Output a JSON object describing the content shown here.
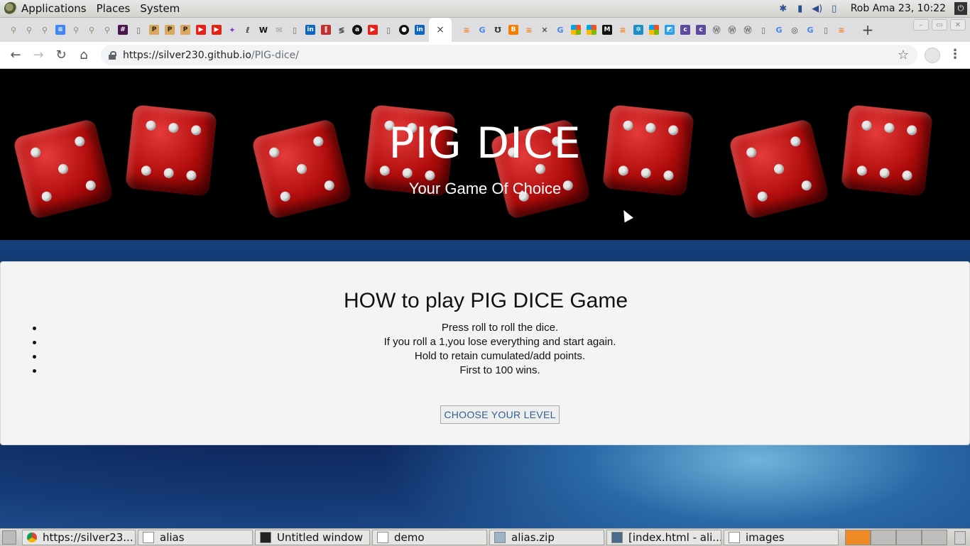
{
  "system_panel": {
    "menus": [
      "Applications",
      "Places",
      "System"
    ],
    "clock": "Rob Ama 23, 10:22"
  },
  "browser": {
    "url_host": "https://silver230.github.io",
    "url_path": "/PIG-dice/",
    "active_tab_close": "×",
    "new_tab": "+"
  },
  "page": {
    "hero_title": "PIG DICE",
    "hero_subtitle": "Your Game Of Choice",
    "card_title": "HOW to play PIG DICE Game",
    "rules": [
      "Press roll to roll the dice.",
      "If you roll a 1,you lose everything and start again.",
      "Hold to retain cumulated/add points.",
      "First to 100 wins."
    ],
    "level_button": "CHOOSE YOUR LEVEL"
  },
  "taskbar": {
    "tasks": [
      {
        "label": "https://silver23...",
        "icon": "chrome-icon"
      },
      {
        "label": "alias",
        "icon": "folder-icon"
      },
      {
        "label": "Untitled window",
        "icon": "terminal-icon"
      },
      {
        "label": "demo",
        "icon": "folder-icon"
      },
      {
        "label": "alias.zip",
        "icon": "archive-icon"
      },
      {
        "label": "[index.html - ali...",
        "icon": "editor-icon"
      },
      {
        "label": "images",
        "icon": "folder-icon"
      }
    ]
  }
}
